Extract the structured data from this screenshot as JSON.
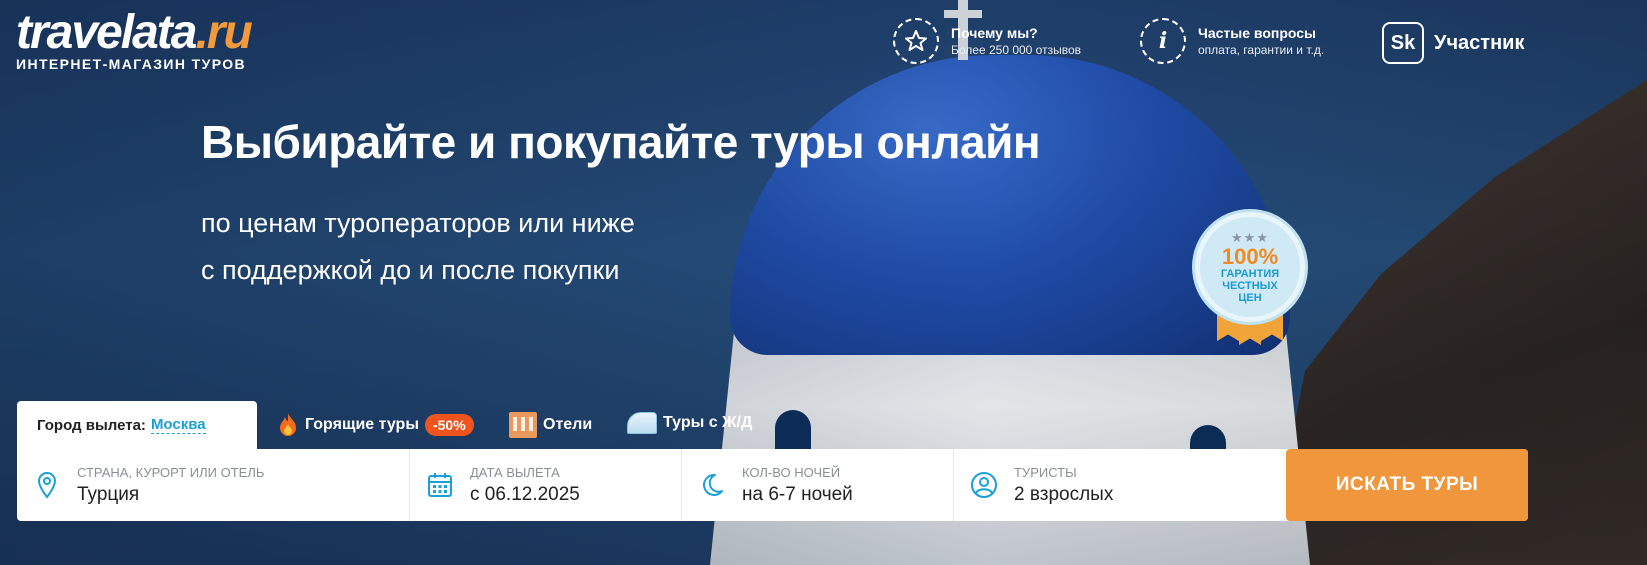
{
  "brand": {
    "logo_main": "travelata",
    "logo_tld": ".ru",
    "tagline": "ИНТЕРНЕТ-МАГАЗИН ТУРОВ",
    "accent_color": "#f0963c",
    "link_color": "#1aa0d8"
  },
  "header": {
    "why_us": {
      "title": "Почему мы?",
      "subtitle": "Более 250 000 отзывов",
      "icon": "star-icon"
    },
    "faq": {
      "title": "Частые вопросы",
      "subtitle": "оплата, гарантии и т.д.",
      "icon": "info-icon"
    },
    "skolkovo": {
      "logo_text": "Sk",
      "label": "Участник"
    }
  },
  "hero": {
    "headline": "Выбирайте и покупайте туры онлайн",
    "subline_1": "по ценам туроператоров или ниже",
    "subline_2": "с поддержкой до и после покупки"
  },
  "badge": {
    "stars": "★★★",
    "percent": "100%",
    "line1": "ГАРАНТИЯ",
    "line2": "ЧЕСТНЫХ",
    "line3": "ЦЕН"
  },
  "tabs": {
    "departure_label": "Город вылета:",
    "departure_city": "Москва",
    "hot_tours": "Горящие туры",
    "hot_discount": "-50%",
    "hotels": "Отели",
    "rail_tours": "Туры с Ж/Д"
  },
  "search": {
    "destination": {
      "label": "СТРАНА, КУРОРТ ИЛИ ОТЕЛЬ",
      "value": "Турция"
    },
    "date": {
      "label": "ДАТА ВЫЛЕТА",
      "value": "с 06.12.2025"
    },
    "nights": {
      "label": "КОЛ-ВО НОЧЕЙ",
      "value": "на 6-7 ночей"
    },
    "tourists": {
      "label": "ТУРИСТЫ",
      "value": "2 взрослых"
    },
    "button": "ИСКАТЬ ТУРЫ"
  }
}
